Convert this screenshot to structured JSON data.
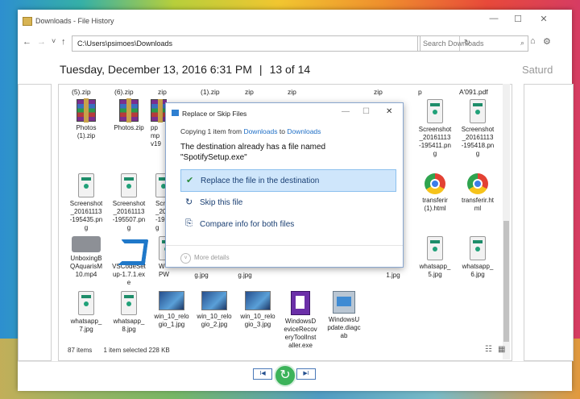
{
  "window": {
    "title": "Downloads - File History",
    "minimize": "—",
    "maximize": "☐",
    "close": "✕"
  },
  "address": {
    "back": "←",
    "forward": "→",
    "dropdown": "˅",
    "up": "↑",
    "path": "C:\\Users\\psimoes\\Downloads",
    "refresh": "↻",
    "search_placeholder": "Search Downloads",
    "search_icon": "⌕",
    "home_icon": "⌂",
    "settings_icon": "⚙"
  },
  "header": {
    "date": "Tuesday, December 13, 2016 6:31 PM",
    "separator": "|",
    "position": "13 of 14",
    "next_date": "Saturd"
  },
  "top_row": [
    "(5).zip",
    "(6).zip",
    "zip",
    "(1).zip",
    "zip",
    "zip",
    "zip",
    "p",
    "A'091.pdf"
  ],
  "files": [
    {
      "l1": "Photos",
      "l2": "(1).zip",
      "l3": "",
      "l4": ""
    },
    {
      "l1": "Photos.zip",
      "l2": "",
      "l3": "",
      "l4": ""
    },
    {
      "l1": "pp",
      "l2": "mp",
      "l3": "v19",
      "l4": ""
    },
    {
      "l1": "Screenshot",
      "l2": "_20161113",
      "l3": "-195411.pn",
      "l4": "g"
    },
    {
      "l1": "Screenshot",
      "l2": "_20161113",
      "l3": "-195418.pn",
      "l4": "g"
    },
    {
      "l1": "Screenshot",
      "l2": "_20161113",
      "l3": "-195435.pn",
      "l4": "g"
    },
    {
      "l1": "Screenshot",
      "l2": "_20161113",
      "l3": "-195507.pn",
      "l4": "g"
    },
    {
      "l1": "Scr",
      "l2": "_20",
      "l3": "-19",
      "l4": "g"
    },
    {
      "l1": "transferir",
      "l2": "(1).html",
      "l3": "",
      "l4": ""
    },
    {
      "l1": "transferir.ht",
      "l2": "ml",
      "l3": "",
      "l4": ""
    },
    {
      "l1": "UnboxingB",
      "l2": "QAquarisM",
      "l3": "10.mp4",
      "l4": ""
    },
    {
      "l1": "VSCodeSet",
      "l2": "up-1.7.1.ex",
      "l3": "e",
      "l4": ""
    },
    {
      "l1": "W",
      "l2": "PW",
      "l3": "",
      "l4": ""
    },
    {
      "l1": "whatsapp_",
      "l2": "5.jpg",
      "l3": "",
      "l4": ""
    },
    {
      "l1": "whatsapp_",
      "l2": "6.jpg",
      "l3": "",
      "l4": ""
    },
    {
      "l1": "whatsapp_",
      "l2": "7.jpg",
      "l3": "",
      "l4": ""
    },
    {
      "l1": "whatsapp_",
      "l2": "8.jpg",
      "l3": "",
      "l4": ""
    },
    {
      "l1": "win_10_relo",
      "l2": "gio_1.jpg",
      "l3": "",
      "l4": ""
    },
    {
      "l1": "win_10_relo",
      "l2": "gio_2.jpg",
      "l3": "",
      "l4": ""
    },
    {
      "l1": "win_10_relo",
      "l2": "gio_3.jpg",
      "l3": "",
      "l4": ""
    },
    {
      "l1": "WindowsD",
      "l2": "eviceRecov",
      "l3": "eryToolInst",
      "l4": "aller.exe"
    },
    {
      "l1": "WindowsU",
      "l2": "pdate.diagc",
      "l3": "ab",
      "l4": ""
    }
  ],
  "partial": [
    "g.jpg",
    "g.jpg",
    "1.jpg"
  ],
  "status": {
    "items": "87 items",
    "selected": "1 item selected",
    "size": "228 KB"
  },
  "view_icons": {
    "details": "☷",
    "tiles": "▦"
  },
  "playback": {
    "prev": "I◀",
    "restore": "↻",
    "next": "▶I"
  },
  "dialog": {
    "title": "Replace or Skip Files",
    "minimize": "—",
    "maximize": "☐",
    "close": "✕",
    "copy_prefix": "Copying 1 item from",
    "from": "Downloads",
    "to_word": "to",
    "to": "Downloads",
    "message_line1": "The destination already has a file named",
    "message_line2": "\"SpotifySetup.exe\"",
    "options": [
      {
        "icon": "✔",
        "label": "Replace the file in the destination"
      },
      {
        "icon": "↻",
        "label": "Skip this file"
      },
      {
        "icon": "⎘",
        "label": "Compare info for both files"
      }
    ],
    "more_icon": "˅",
    "more_label": "More details"
  }
}
